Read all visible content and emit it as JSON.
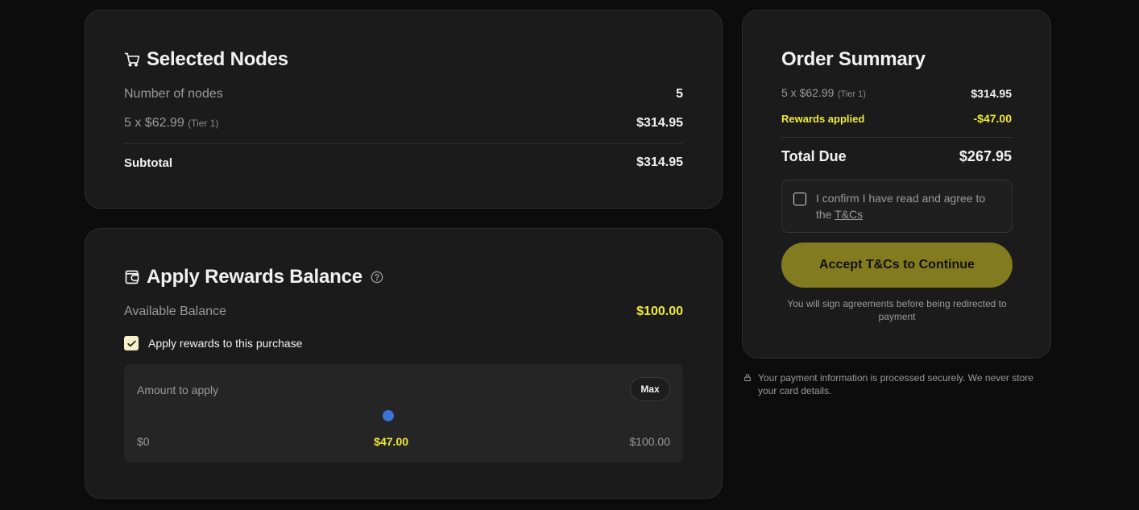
{
  "selected_nodes": {
    "title": "Selected Nodes",
    "number_label": "Number of nodes",
    "number_value": "5",
    "price_label": "5 x $62.99",
    "tier": "(Tier 1)",
    "price_value": "$314.95",
    "subtotal_label": "Subtotal",
    "subtotal_value": "$314.95",
    "icon": "cart-icon"
  },
  "rewards": {
    "title": "Apply Rewards Balance",
    "icon": "wallet-icon",
    "help_icon": "help-circle-icon",
    "available_label": "Available Balance",
    "available_value": "$100.00",
    "apply_checkbox_label": "Apply rewards to this purchase",
    "apply_checked": true,
    "amount_label": "Amount to apply",
    "max_label": "Max",
    "slider_min_label": "$0",
    "slider_current_label": "$47.00",
    "slider_max_label": "$100.00",
    "slider_value": 47,
    "slider_max": 100
  },
  "order_summary": {
    "title": "Order Summary",
    "line_label": "5 x $62.99",
    "line_tier": "(Tier 1)",
    "line_value": "$314.95",
    "rewards_label": "Rewards applied",
    "rewards_value": "-$47.00",
    "total_label": "Total Due",
    "total_value": "$267.95",
    "tc_text": "I confirm I have read and agree to the",
    "tc_link": "T&Cs",
    "tc_checked": false,
    "accept_button": "Accept T&Cs to Continue",
    "redirect_note": "You will sign agreements before being redirected to payment"
  },
  "secure_note": "Your payment information is processed securely. We never store your card details.",
  "colors": {
    "accent_yellow": "#f1ea3a",
    "button_olive": "#827b20",
    "slider_blue": "#3b73d6",
    "card_bg": "#1b1b1b",
    "page_bg": "#0c0c0c"
  }
}
